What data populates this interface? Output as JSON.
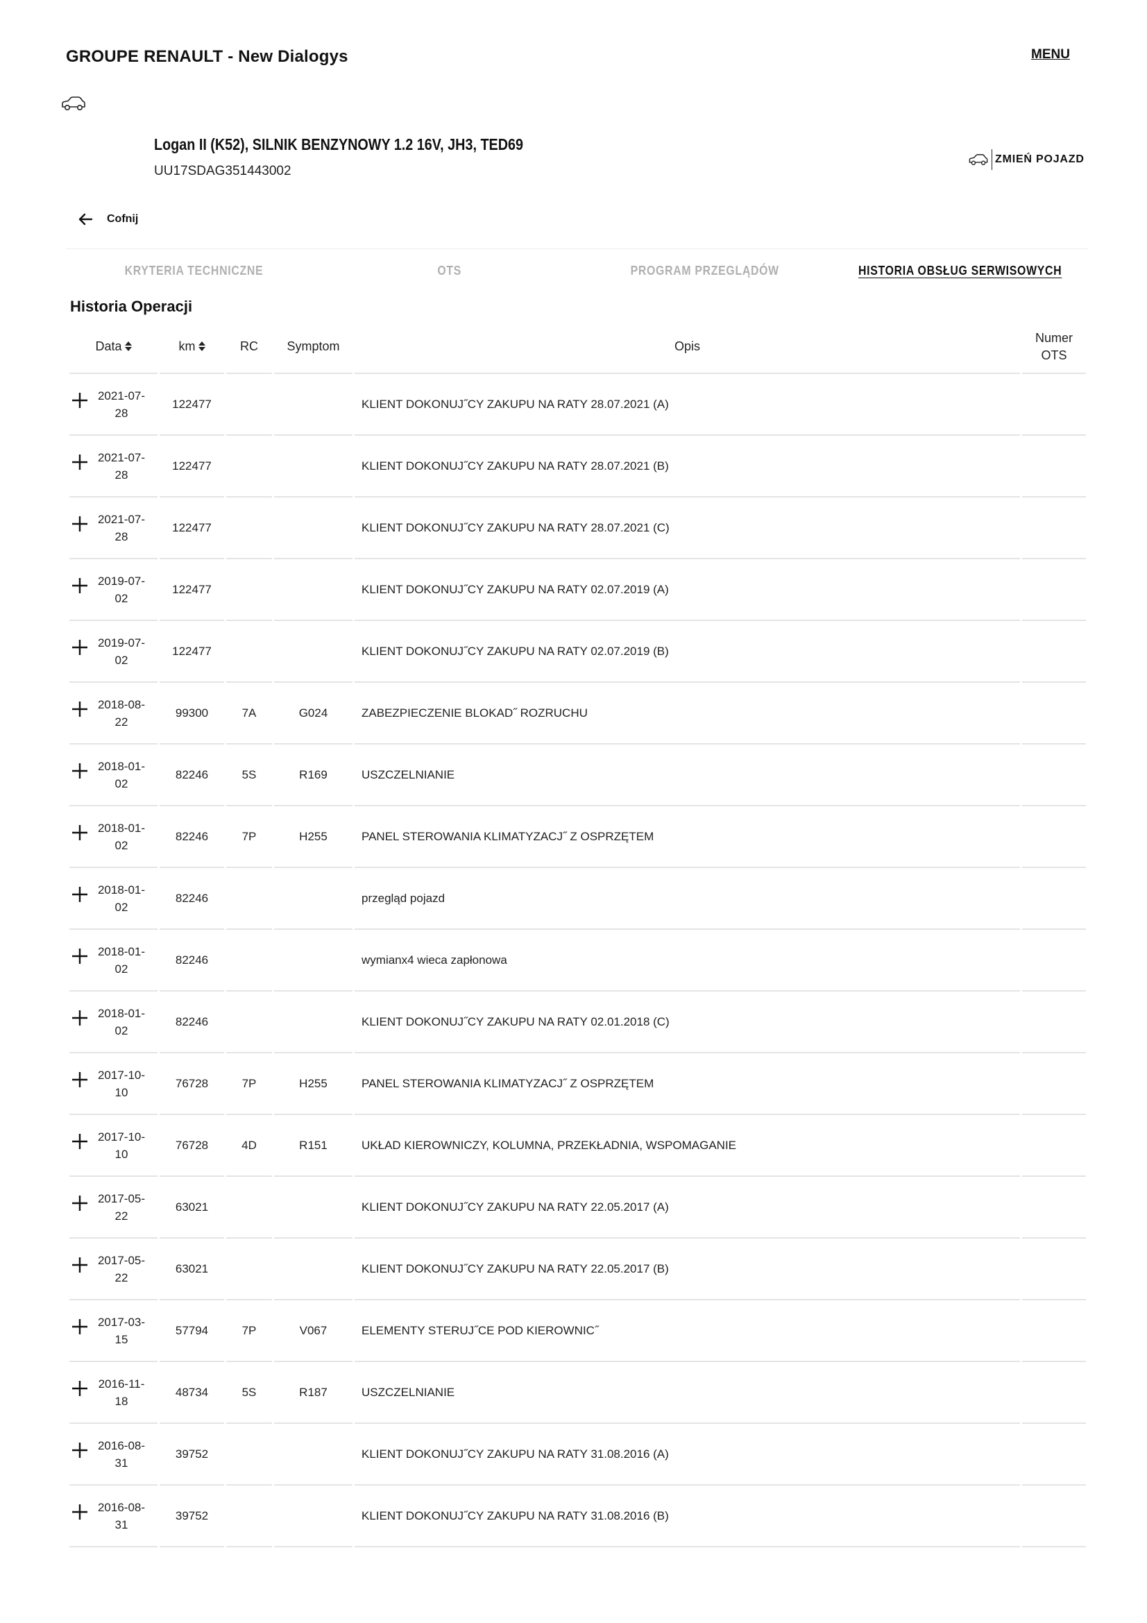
{
  "header": {
    "app_title": "GROUPE RENAULT -  New Dialogys",
    "menu_label": "MENU"
  },
  "vehicle": {
    "name": "Logan II (K52), SILNIK BENZYNOWY 1.2 16V, JH3, TED69",
    "vin": "UU17SDAG351443002",
    "change_label": "ZMIEŃ POJAZD"
  },
  "nav": {
    "back_label": "Cofnij"
  },
  "tabs": [
    {
      "label": "KRYTERIA TECHNICZNE",
      "active": false
    },
    {
      "label": "OTS",
      "active": false
    },
    {
      "label": "PROGRAM PRZEGLĄDÓW",
      "active": false
    },
    {
      "label": "HISTORIA OBSŁUG SERWISOWYCH",
      "active": true
    }
  ],
  "history": {
    "title": "Historia Operacji",
    "columns": {
      "date": "Data",
      "km": "km",
      "rc": "RC",
      "symptom": "Symptom",
      "opis": "Opis",
      "ots_line1": "Numer",
      "ots_line2": "OTS"
    },
    "rows": [
      {
        "date": "2021-07-28",
        "km": "122477",
        "rc": "",
        "symptom": "",
        "opis": "KLIENT DOKONUJ˝CY ZAKUPU NA RATY 28.07.2021 (A)",
        "ots": ""
      },
      {
        "date": "2021-07-28",
        "km": "122477",
        "rc": "",
        "symptom": "",
        "opis": "KLIENT DOKONUJ˝CY ZAKUPU NA RATY 28.07.2021 (B)",
        "ots": ""
      },
      {
        "date": "2021-07-28",
        "km": "122477",
        "rc": "",
        "symptom": "",
        "opis": "KLIENT DOKONUJ˝CY ZAKUPU NA RATY 28.07.2021 (C)",
        "ots": ""
      },
      {
        "date": "2019-07-02",
        "km": "122477",
        "rc": "",
        "symptom": "",
        "opis": "KLIENT DOKONUJ˝CY ZAKUPU NA RATY 02.07.2019 (A)",
        "ots": ""
      },
      {
        "date": "2019-07-02",
        "km": "122477",
        "rc": "",
        "symptom": "",
        "opis": "KLIENT DOKONUJ˝CY ZAKUPU NA RATY 02.07.2019 (B)",
        "ots": ""
      },
      {
        "date": "2018-08-22",
        "km": "99300",
        "rc": "7A",
        "symptom": "G024",
        "opis": "ZABEZPIECZENIE BLOKAD˝ ROZRUCHU",
        "ots": ""
      },
      {
        "date": "2018-01-02",
        "km": "82246",
        "rc": "5S",
        "symptom": "R169",
        "opis": "USZCZELNIANIE",
        "ots": ""
      },
      {
        "date": "2018-01-02",
        "km": "82246",
        "rc": "7P",
        "symptom": "H255",
        "opis": "PANEL STEROWANIA KLIMATYZACJ˝ Z OSPRZĘTEM",
        "ots": ""
      },
      {
        "date": "2018-01-02",
        "km": "82246",
        "rc": "",
        "symptom": "",
        "opis": "przegląd pojazd",
        "ots": ""
      },
      {
        "date": "2018-01-02",
        "km": "82246",
        "rc": "",
        "symptom": "",
        "opis": "wymianx4 wieca zapłonowa",
        "ots": ""
      },
      {
        "date": "2018-01-02",
        "km": "82246",
        "rc": "",
        "symptom": "",
        "opis": "KLIENT DOKONUJ˝CY ZAKUPU NA RATY 02.01.2018 (C)",
        "ots": ""
      },
      {
        "date": "2017-10-10",
        "km": "76728",
        "rc": "7P",
        "symptom": "H255",
        "opis": "PANEL STEROWANIA KLIMATYZACJ˝ Z OSPRZĘTEM",
        "ots": ""
      },
      {
        "date": "2017-10-10",
        "km": "76728",
        "rc": "4D",
        "symptom": "R151",
        "opis": "UKŁAD KIEROWNICZY, KOLUMNA, PRZEKŁADNIA, WSPOMAGANIE",
        "ots": ""
      },
      {
        "date": "2017-05-22",
        "km": "63021",
        "rc": "",
        "symptom": "",
        "opis": "KLIENT DOKONUJ˝CY ZAKUPU NA RATY 22.05.2017 (A)",
        "ots": ""
      },
      {
        "date": "2017-05-22",
        "km": "63021",
        "rc": "",
        "symptom": "",
        "opis": "KLIENT DOKONUJ˝CY ZAKUPU NA RATY 22.05.2017 (B)",
        "ots": ""
      },
      {
        "date": "2017-03-15",
        "km": "57794",
        "rc": "7P",
        "symptom": "V067",
        "opis": "ELEMENTY STERUJ˝CE POD KIEROWNIC˝",
        "ots": ""
      },
      {
        "date": "2016-11-18",
        "km": "48734",
        "rc": "5S",
        "symptom": "R187",
        "opis": "USZCZELNIANIE",
        "ots": ""
      },
      {
        "date": "2016-08-31",
        "km": "39752",
        "rc": "",
        "symptom": "",
        "opis": "KLIENT DOKONUJ˝CY ZAKUPU NA RATY 31.08.2016 (A)",
        "ots": ""
      },
      {
        "date": "2016-08-31",
        "km": "39752",
        "rc": "",
        "symptom": "",
        "opis": "KLIENT DOKONUJ˝CY ZAKUPU NA RATY 31.08.2016 (B)",
        "ots": ""
      }
    ]
  },
  "icons": {
    "car": "car-outline-icon",
    "back": "arrow-left-icon",
    "sort": "sort-updown-icon",
    "expand": "plus-icon"
  }
}
